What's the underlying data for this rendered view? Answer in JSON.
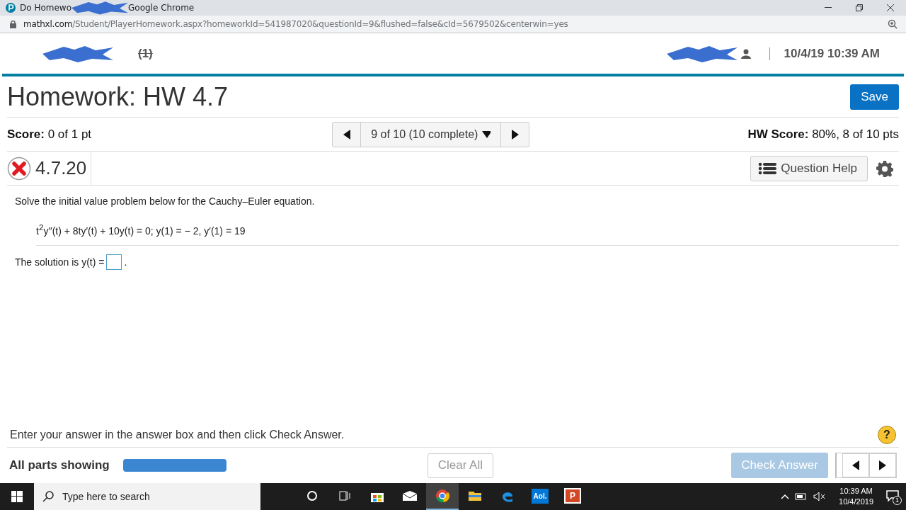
{
  "browser": {
    "title_start": "Do Homewo",
    "title_end": "Google Chrome",
    "url_host": "mathxl.com",
    "url_path": "/Student/PlayerHomework.aspx?homeworkId=541987020&questionId=9&flushed=false&cId=5679502&centerwin=yes"
  },
  "header": {
    "course_tail": "(1)",
    "datetime": "10/4/19 10:39 AM"
  },
  "homework": {
    "title": "Homework: HW 4.7",
    "save": "Save"
  },
  "score": {
    "label": "Score:",
    "value": "0 of 1 pt",
    "nav": "9 of 10 (10 complete)",
    "hw_label": "HW Score:",
    "hw_value": "80%, 8 of 10 pts"
  },
  "question": {
    "number": "4.7.20",
    "correct": false,
    "help": "Question Help"
  },
  "problem": {
    "intro": "Solve the initial value problem below for the Cauchy–Euler equation.",
    "equation": "t$^{2}$y′′(t) + 8ty′(t) + 10y(t) = 0; y(1) =  − 2, y′(1) = 19",
    "answer_prefix": "The solution is y(t) =",
    "answer_suffix": "."
  },
  "footer": {
    "instruction": "Enter your answer in the answer box and then click Check Answer.",
    "help_mark": "?",
    "parts": "All parts showing",
    "clear": "Clear All",
    "check": "Check Answer",
    "check_disabled": true
  },
  "taskbar": {
    "search_placeholder": "Type here to search",
    "apps": [
      {
        "kind": "cortana",
        "selected": false
      },
      {
        "kind": "taskview",
        "selected": false
      },
      {
        "kind": "store",
        "selected": false
      },
      {
        "kind": "mail",
        "selected": false
      },
      {
        "kind": "chrome",
        "selected": true
      },
      {
        "kind": "files",
        "selected": false
      },
      {
        "kind": "edge",
        "selected": false
      },
      {
        "kind": "aol",
        "label": "Aol.",
        "selected": false
      },
      {
        "kind": "powerpoint",
        "label": "P",
        "selected": false
      }
    ],
    "time": "10:39 AM",
    "date": "10/4/2019",
    "notifications": "1"
  }
}
